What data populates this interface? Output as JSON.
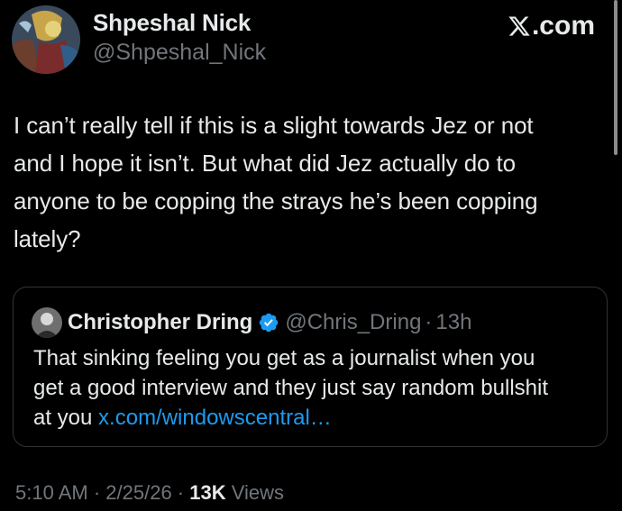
{
  "author": {
    "name": "Shpeshal Nick",
    "handle": "@Shpeshal_Nick"
  },
  "brand": {
    "text": ".com",
    "icon": "x-logo-icon"
  },
  "tweet": {
    "lines": [
      "I can’t really tell if this is a slight towards Jez or not",
      "and I hope it isn’t. But what did Jez actually do to",
      "anyone to be copping the strays he’s been copping",
      "lately?"
    ]
  },
  "quote": {
    "name": "Christopher Dring",
    "handle": "@Chris_Dring",
    "separator": "·",
    "time": "13h",
    "lines": [
      "That sinking feeling you get as a journalist when you",
      "get a good interview and they just say random bullshit"
    ],
    "last_line_prefix": "at you ",
    "link_text": "x.com/windowscentral…",
    "verified_icon": "verified-badge-icon",
    "accent_color": "#1d9bf0"
  },
  "meta": {
    "time": "5:10 AM",
    "sep1": " · ",
    "date": "2/25/26",
    "sep2": " · ",
    "views_count": "13K",
    "views_label": " Views"
  }
}
